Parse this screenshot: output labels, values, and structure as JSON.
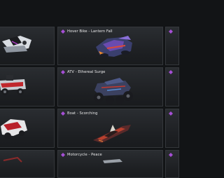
{
  "colors": {
    "rarity_purple": "#a64fd6",
    "tile_bg": "#24272a",
    "page_bg": "#121416",
    "label_text": "#e9e9ea"
  },
  "grid": {
    "tiles": [
      {
        "label": "Hover Bike - Lantern Fall",
        "rarity_icon": "rarity-diamond-icon"
      },
      {
        "label": "ATV - Ethereal Surge",
        "rarity_icon": "rarity-diamond-icon"
      },
      {
        "label": "Boat - Scorching",
        "rarity_icon": "rarity-diamond-icon"
      },
      {
        "label": "Motorcycle - Peace",
        "rarity_icon": "rarity-diamond-icon"
      }
    ]
  }
}
